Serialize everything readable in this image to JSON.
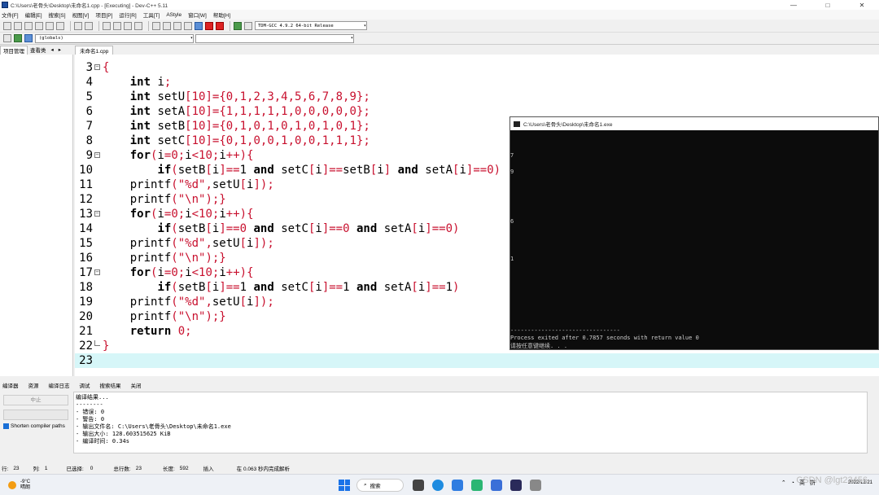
{
  "window": {
    "title": "C:\\Users\\老骨头\\Desktop\\未命名1.cpp - [Executing] - Dev-C++ 5.11",
    "min": "—",
    "max": "□",
    "close": "✕"
  },
  "menu": [
    "文件[F]",
    "编辑[E]",
    "搜索[S]",
    "视图[V]",
    "项目[P]",
    "运行[R]",
    "工具[T]",
    "AStyle",
    "窗口[W]",
    "帮助[H]"
  ],
  "toolbar": {
    "compiler": "TDM-GCC 4.9.2 64-bit Release",
    "globals": "(globals)"
  },
  "left_tabs": [
    "项目管理",
    "查看类"
  ],
  "file_tab": "未命名1.cpp",
  "code_lines": [
    {
      "n": "3",
      "fold": "−",
      "html": "<span class=\"red\">{</span>"
    },
    {
      "n": "4",
      "fold": "",
      "html": "    <span class=\"kw\">int</span> i<span class=\"red\">;</span>"
    },
    {
      "n": "5",
      "fold": "",
      "html": "    <span class=\"kw\">int</span> setU<span class=\"red\">[10]={0,1,2,3,4,5,6,7,8,9};</span>"
    },
    {
      "n": "6",
      "fold": "",
      "html": "    <span class=\"kw\">int</span> setA<span class=\"red\">[10]={1,1,1,1,1,0,0,0,0,0};</span>"
    },
    {
      "n": "7",
      "fold": "",
      "html": "    <span class=\"kw\">int</span> setB<span class=\"red\">[10]={0,1,0,1,0,1,0,1,0,1};</span>"
    },
    {
      "n": "8",
      "fold": "",
      "html": "    <span class=\"kw\">int</span> setC<span class=\"red\">[10]={0,1,0,0,1,0,0,1,1,1};</span>"
    },
    {
      "n": "9",
      "fold": "−",
      "html": "    <span class=\"kw\">for</span><span class=\"red\">(</span>i<span class=\"red\">=0;</span>i<span class=\"red\">&lt;10;</span>i<span class=\"red\">++){</span>"
    },
    {
      "n": "10",
      "fold": "",
      "html": "        <span class=\"kw\">if</span><span class=\"red\">(</span>setB<span class=\"red\">[</span>i<span class=\"red\">]==</span>1 <span class=\"kw\">and</span> setC<span class=\"red\">[</span>i<span class=\"red\">]==</span>setB<span class=\"red\">[</span>i<span class=\"red\">]</span> <span class=\"kw\">and</span> setA<span class=\"red\">[</span>i<span class=\"red\">]==0)</span>"
    },
    {
      "n": "11",
      "fold": "",
      "html": "    printf<span class=\"red\">(\"%d\",</span>setU<span class=\"red\">[</span>i<span class=\"red\">]);</span>"
    },
    {
      "n": "12",
      "fold": "",
      "html": "    printf<span class=\"red\">(\"\\n\");}</span>"
    },
    {
      "n": "13",
      "fold": "−",
      "html": "    <span class=\"kw\">for</span><span class=\"red\">(</span>i<span class=\"red\">=0;</span>i<span class=\"red\">&lt;10;</span>i<span class=\"red\">++){</span>"
    },
    {
      "n": "14",
      "fold": "",
      "html": "        <span class=\"kw\">if</span><span class=\"red\">(</span>setB<span class=\"red\">[</span>i<span class=\"red\">]==0</span> <span class=\"kw\">and</span> setC<span class=\"red\">[</span>i<span class=\"red\">]==0</span> <span class=\"kw\">and</span> setA<span class=\"red\">[</span>i<span class=\"red\">]==0)</span>"
    },
    {
      "n": "15",
      "fold": "",
      "html": "    printf<span class=\"red\">(\"%d\",</span>setU<span class=\"red\">[</span>i<span class=\"red\">]);</span>"
    },
    {
      "n": "16",
      "fold": "",
      "html": "    printf<span class=\"red\">(\"\\n\");}</span>"
    },
    {
      "n": "17",
      "fold": "−",
      "html": "    <span class=\"kw\">for</span><span class=\"red\">(</span>i<span class=\"red\">=0;</span>i<span class=\"red\">&lt;10;</span>i<span class=\"red\">++){</span>"
    },
    {
      "n": "18",
      "fold": "",
      "html": "        <span class=\"kw\">if</span><span class=\"red\">(</span>setB<span class=\"red\">[</span>i<span class=\"red\">]==</span>1 <span class=\"kw\">and</span> setC<span class=\"red\">[</span>i<span class=\"red\">]==</span>1 <span class=\"kw\">and</span> setA<span class=\"red\">[</span>i<span class=\"red\">]==</span>1<span class=\"red\">)</span>"
    },
    {
      "n": "19",
      "fold": "",
      "html": "    printf<span class=\"red\">(\"%d\",</span>setU<span class=\"red\">[</span>i<span class=\"red\">]);</span>"
    },
    {
      "n": "20",
      "fold": "",
      "html": "    printf<span class=\"red\">(\"\\n\");}</span>"
    },
    {
      "n": "21",
      "fold": "",
      "html": "    <span class=\"kw\">return</span> <span class=\"red\">0;</span>"
    },
    {
      "n": "22",
      "fold": "└",
      "html": "<span class=\"red\">}</span>"
    },
    {
      "n": "23",
      "fold": "",
      "html": ""
    }
  ],
  "console": {
    "title": "C:\\Users\\老骨头\\Desktop\\未命名1.exe",
    "lines": [
      {
        "text": "7"
      },
      {
        "text": "9"
      },
      {
        "text": "6"
      },
      {
        "text": "1"
      },
      {
        "text": "--------------------------------"
      },
      {
        "text": "Process exited after 0.7857 seconds with return value 0"
      },
      {
        "text": "请按任意键继续. . ."
      }
    ]
  },
  "bottom_tabs": [
    "编译器",
    "资源",
    "编译日志",
    "调试",
    "搜索结果",
    "关闭"
  ],
  "stop_button": "中止",
  "shorten_label": "Shorten compiler paths",
  "output_text": "编译结果...\n--------\n- 错误: 0\n- 警告: 0\n- 输出文件名: C:\\Users\\老骨头\\Desktop\\未命名1.exe\n- 输出大小: 128.603515625 KiB\n- 编译时间: 0.34s",
  "status": {
    "row_label": "行:",
    "row": "23",
    "col_label": "列:",
    "col": "1",
    "sel_label": "已选择:",
    "sel": "0",
    "total_label": "总行数:",
    "total": "23",
    "len_label": "长度:",
    "len": "592",
    "mode": "插入",
    "parse": "在 0.063 秒内完成解析"
  },
  "taskbar": {
    "temp": "-9°C",
    "weather": "晴朗",
    "search": "搜索",
    "ime1": "英",
    "ime2": "拼",
    "date": "2022/12/21",
    "watermark": "CSDN @lgt23456"
  }
}
